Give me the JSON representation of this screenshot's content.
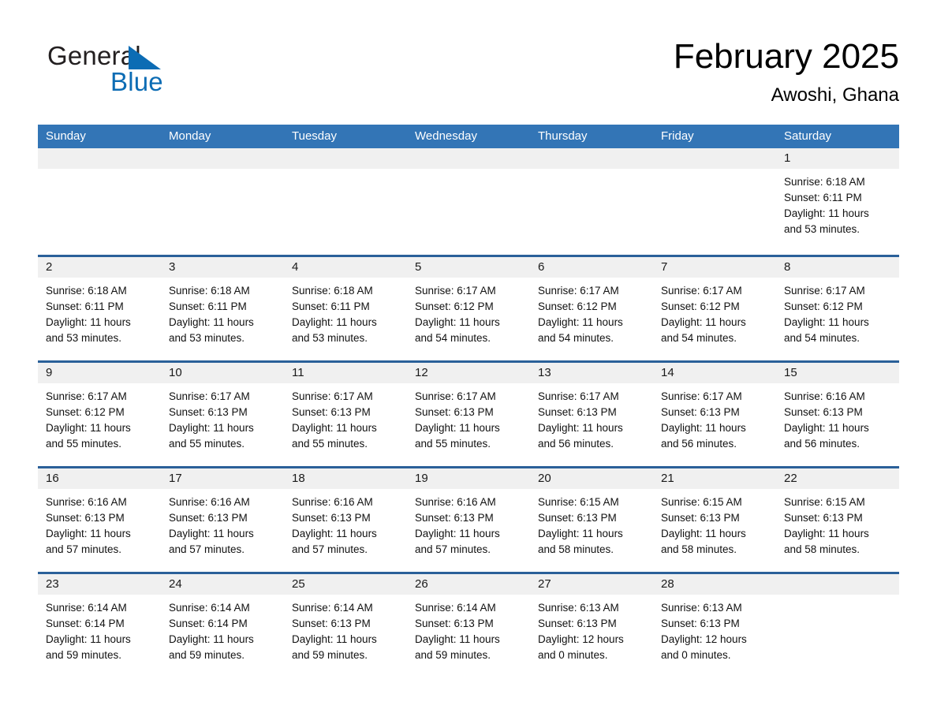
{
  "brand": {
    "name_part1": "General",
    "name_part2": "Blue",
    "flag_icon": "triangle-flag-icon",
    "accent_color": "#0c6cb4"
  },
  "header": {
    "title": "February 2025",
    "location": "Awoshi, Ghana"
  },
  "calendar": {
    "header_color": "#3375b6",
    "row_divider_color": "#2a6099",
    "day_number_band_color": "#f0f0f0",
    "weekday_names": [
      "Sunday",
      "Monday",
      "Tuesday",
      "Wednesday",
      "Thursday",
      "Friday",
      "Saturday"
    ],
    "weeks": [
      [
        {
          "day": "",
          "sunrise": "",
          "sunset": "",
          "daylight": "",
          "daylight2": ""
        },
        {
          "day": "",
          "sunrise": "",
          "sunset": "",
          "daylight": "",
          "daylight2": ""
        },
        {
          "day": "",
          "sunrise": "",
          "sunset": "",
          "daylight": "",
          "daylight2": ""
        },
        {
          "day": "",
          "sunrise": "",
          "sunset": "",
          "daylight": "",
          "daylight2": ""
        },
        {
          "day": "",
          "sunrise": "",
          "sunset": "",
          "daylight": "",
          "daylight2": ""
        },
        {
          "day": "",
          "sunrise": "",
          "sunset": "",
          "daylight": "",
          "daylight2": ""
        },
        {
          "day": "1",
          "sunrise": "Sunrise: 6:18 AM",
          "sunset": "Sunset: 6:11 PM",
          "daylight": "Daylight: 11 hours",
          "daylight2": "and 53 minutes."
        }
      ],
      [
        {
          "day": "2",
          "sunrise": "Sunrise: 6:18 AM",
          "sunset": "Sunset: 6:11 PM",
          "daylight": "Daylight: 11 hours",
          "daylight2": "and 53 minutes."
        },
        {
          "day": "3",
          "sunrise": "Sunrise: 6:18 AM",
          "sunset": "Sunset: 6:11 PM",
          "daylight": "Daylight: 11 hours",
          "daylight2": "and 53 minutes."
        },
        {
          "day": "4",
          "sunrise": "Sunrise: 6:18 AM",
          "sunset": "Sunset: 6:11 PM",
          "daylight": "Daylight: 11 hours",
          "daylight2": "and 53 minutes."
        },
        {
          "day": "5",
          "sunrise": "Sunrise: 6:17 AM",
          "sunset": "Sunset: 6:12 PM",
          "daylight": "Daylight: 11 hours",
          "daylight2": "and 54 minutes."
        },
        {
          "day": "6",
          "sunrise": "Sunrise: 6:17 AM",
          "sunset": "Sunset: 6:12 PM",
          "daylight": "Daylight: 11 hours",
          "daylight2": "and 54 minutes."
        },
        {
          "day": "7",
          "sunrise": "Sunrise: 6:17 AM",
          "sunset": "Sunset: 6:12 PM",
          "daylight": "Daylight: 11 hours",
          "daylight2": "and 54 minutes."
        },
        {
          "day": "8",
          "sunrise": "Sunrise: 6:17 AM",
          "sunset": "Sunset: 6:12 PM",
          "daylight": "Daylight: 11 hours",
          "daylight2": "and 54 minutes."
        }
      ],
      [
        {
          "day": "9",
          "sunrise": "Sunrise: 6:17 AM",
          "sunset": "Sunset: 6:12 PM",
          "daylight": "Daylight: 11 hours",
          "daylight2": "and 55 minutes."
        },
        {
          "day": "10",
          "sunrise": "Sunrise: 6:17 AM",
          "sunset": "Sunset: 6:13 PM",
          "daylight": "Daylight: 11 hours",
          "daylight2": "and 55 minutes."
        },
        {
          "day": "11",
          "sunrise": "Sunrise: 6:17 AM",
          "sunset": "Sunset: 6:13 PM",
          "daylight": "Daylight: 11 hours",
          "daylight2": "and 55 minutes."
        },
        {
          "day": "12",
          "sunrise": "Sunrise: 6:17 AM",
          "sunset": "Sunset: 6:13 PM",
          "daylight": "Daylight: 11 hours",
          "daylight2": "and 55 minutes."
        },
        {
          "day": "13",
          "sunrise": "Sunrise: 6:17 AM",
          "sunset": "Sunset: 6:13 PM",
          "daylight": "Daylight: 11 hours",
          "daylight2": "and 56 minutes."
        },
        {
          "day": "14",
          "sunrise": "Sunrise: 6:17 AM",
          "sunset": "Sunset: 6:13 PM",
          "daylight": "Daylight: 11 hours",
          "daylight2": "and 56 minutes."
        },
        {
          "day": "15",
          "sunrise": "Sunrise: 6:16 AM",
          "sunset": "Sunset: 6:13 PM",
          "daylight": "Daylight: 11 hours",
          "daylight2": "and 56 minutes."
        }
      ],
      [
        {
          "day": "16",
          "sunrise": "Sunrise: 6:16 AM",
          "sunset": "Sunset: 6:13 PM",
          "daylight": "Daylight: 11 hours",
          "daylight2": "and 57 minutes."
        },
        {
          "day": "17",
          "sunrise": "Sunrise: 6:16 AM",
          "sunset": "Sunset: 6:13 PM",
          "daylight": "Daylight: 11 hours",
          "daylight2": "and 57 minutes."
        },
        {
          "day": "18",
          "sunrise": "Sunrise: 6:16 AM",
          "sunset": "Sunset: 6:13 PM",
          "daylight": "Daylight: 11 hours",
          "daylight2": "and 57 minutes."
        },
        {
          "day": "19",
          "sunrise": "Sunrise: 6:16 AM",
          "sunset": "Sunset: 6:13 PM",
          "daylight": "Daylight: 11 hours",
          "daylight2": "and 57 minutes."
        },
        {
          "day": "20",
          "sunrise": "Sunrise: 6:15 AM",
          "sunset": "Sunset: 6:13 PM",
          "daylight": "Daylight: 11 hours",
          "daylight2": "and 58 minutes."
        },
        {
          "day": "21",
          "sunrise": "Sunrise: 6:15 AM",
          "sunset": "Sunset: 6:13 PM",
          "daylight": "Daylight: 11 hours",
          "daylight2": "and 58 minutes."
        },
        {
          "day": "22",
          "sunrise": "Sunrise: 6:15 AM",
          "sunset": "Sunset: 6:13 PM",
          "daylight": "Daylight: 11 hours",
          "daylight2": "and 58 minutes."
        }
      ],
      [
        {
          "day": "23",
          "sunrise": "Sunrise: 6:14 AM",
          "sunset": "Sunset: 6:14 PM",
          "daylight": "Daylight: 11 hours",
          "daylight2": "and 59 minutes."
        },
        {
          "day": "24",
          "sunrise": "Sunrise: 6:14 AM",
          "sunset": "Sunset: 6:14 PM",
          "daylight": "Daylight: 11 hours",
          "daylight2": "and 59 minutes."
        },
        {
          "day": "25",
          "sunrise": "Sunrise: 6:14 AM",
          "sunset": "Sunset: 6:13 PM",
          "daylight": "Daylight: 11 hours",
          "daylight2": "and 59 minutes."
        },
        {
          "day": "26",
          "sunrise": "Sunrise: 6:14 AM",
          "sunset": "Sunset: 6:13 PM",
          "daylight": "Daylight: 11 hours",
          "daylight2": "and 59 minutes."
        },
        {
          "day": "27",
          "sunrise": "Sunrise: 6:13 AM",
          "sunset": "Sunset: 6:13 PM",
          "daylight": "Daylight: 12 hours",
          "daylight2": "and 0 minutes."
        },
        {
          "day": "28",
          "sunrise": "Sunrise: 6:13 AM",
          "sunset": "Sunset: 6:13 PM",
          "daylight": "Daylight: 12 hours",
          "daylight2": "and 0 minutes."
        },
        {
          "day": "",
          "sunrise": "",
          "sunset": "",
          "daylight": "",
          "daylight2": ""
        }
      ]
    ]
  }
}
